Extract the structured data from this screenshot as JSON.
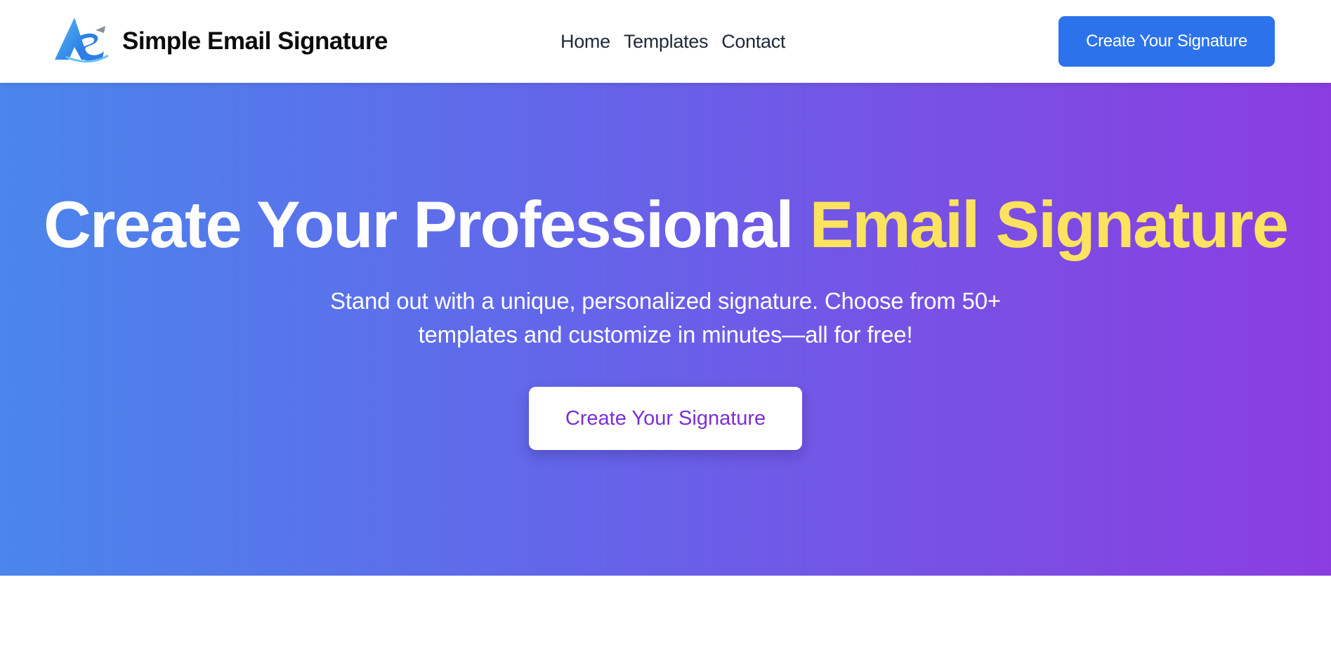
{
  "colors": {
    "nav_cta_bg": "#2c73eb",
    "hero_gradient_start": "#4a86ec",
    "hero_gradient_end": "#8b3de2",
    "accent_yellow": "#fbe25f",
    "hero_cta_text": "#7a2fd8"
  },
  "header": {
    "logo_icon": "as-monogram-logo",
    "brand_name": "Simple Email Signature",
    "nav": [
      {
        "label": "Home"
      },
      {
        "label": "Templates"
      },
      {
        "label": "Contact"
      }
    ],
    "cta_label": "Create Your Signature"
  },
  "hero": {
    "title_main": "Create Your Professional ",
    "title_accent": "Email Signature",
    "subtitle": "Stand out with a unique, personalized signature. Choose from 50+ templates and customize in minutes—all for free!",
    "cta_label": "Create Your Signature"
  }
}
